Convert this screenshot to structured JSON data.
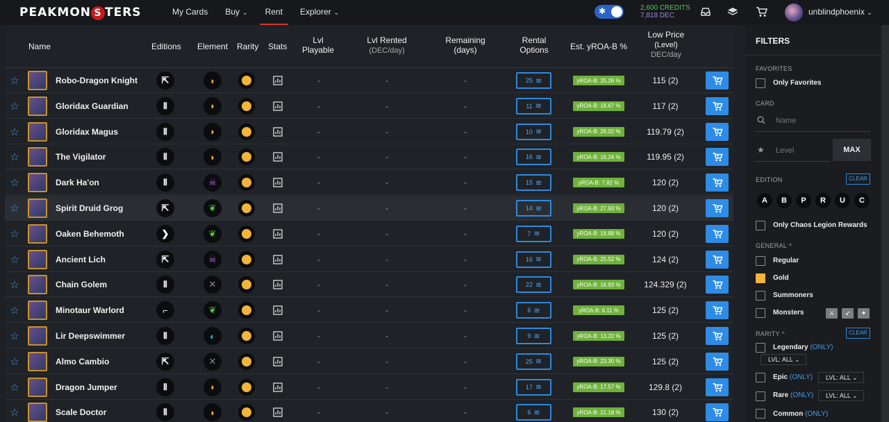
{
  "header": {
    "logo_pre": "PEAKMON",
    "logo_s": "S",
    "logo_post": "TERS",
    "nav": [
      {
        "label": "My Cards",
        "chevron": ""
      },
      {
        "label": "Buy",
        "chevron": "⌄"
      },
      {
        "label": "Rent",
        "chevron": ""
      },
      {
        "label": "Explorer",
        "chevron": "⌄"
      }
    ],
    "credits": "2,600 CREDITS",
    "dec": "7,818 DEC",
    "username": "unblindphoenix"
  },
  "table": {
    "headers": {
      "name": "Name",
      "editions": "Editions",
      "element": "Element",
      "rarity": "Rarity",
      "stats": "Stats",
      "lvl_playable_1": "Lvl",
      "lvl_playable_2": "Playable",
      "lvl_rented": "Lvl Rented",
      "lvl_rented_sub": "(DEC/day)",
      "remaining_1": "Remaining",
      "remaining_2": "(days)",
      "rental_1": "Rental",
      "rental_2": "Options",
      "yroa": "Est. yROA-B %",
      "low_price": "Low Price",
      "low_price_level": "(Level)",
      "low_price_sub": "DEC/day"
    },
    "rows": [
      {
        "name": "Robo-Dragon Knight",
        "edition": "R",
        "element": "fire",
        "options": "25",
        "yroa": "yROA-B: 25.26 %",
        "price": "115 (2)"
      },
      {
        "name": "Gloridax Guardian",
        "edition": "U",
        "element": "fire",
        "options": "11",
        "yroa": "yROA-B: 18.67 %",
        "price": "117 (2)"
      },
      {
        "name": "Gloridax Magus",
        "edition": "U",
        "element": "fire",
        "options": "10",
        "yroa": "yROA-B: 26.02 %",
        "price": "119.79 (2)"
      },
      {
        "name": "The Vigilator",
        "edition": "U",
        "element": "fire",
        "options": "16",
        "yroa": "yROA-B: 16.24 %",
        "price": "119.95 (2)"
      },
      {
        "name": "Dark Ha'on",
        "edition": "U",
        "element": "death",
        "options": "15",
        "yroa": "yROA-B: 7.82 %",
        "price": "120 (2)"
      },
      {
        "name": "Spirit Druid Grog",
        "edition": "R",
        "element": "earth",
        "options": "14",
        "yroa": "yROA-B: 27.93 %",
        "price": "120 (2)"
      },
      {
        "name": "Oaken Behemoth",
        "edition": "C",
        "element": "earth",
        "options": "7",
        "yroa": "yROA-B: 18.88 %",
        "price": "120 (2)"
      },
      {
        "name": "Ancient Lich",
        "edition": "R",
        "element": "death",
        "options": "16",
        "yroa": "yROA-B: 25.52 %",
        "price": "124 (2)"
      },
      {
        "name": "Chain Golem",
        "edition": "U",
        "element": "neutral",
        "options": "22",
        "yroa": "yROA-B: 16.93 %",
        "price": "124.329 (2)"
      },
      {
        "name": "Minotaur Warlord",
        "edition": "P",
        "element": "earth",
        "options": "6",
        "yroa": "yROA-B: 6.11 %",
        "price": "125 (2)"
      },
      {
        "name": "Lir Deepswimmer",
        "edition": "U",
        "element": "water",
        "options": "9",
        "yroa": "yROA-B: 13.22 %",
        "price": "125 (2)"
      },
      {
        "name": "Almo Cambio",
        "edition": "R",
        "element": "neutral",
        "options": "25",
        "yroa": "yROA-B: 23.30 %",
        "price": "125 (2)"
      },
      {
        "name": "Dragon Jumper",
        "edition": "U",
        "element": "fire",
        "options": "17",
        "yroa": "yROA-B: 17.57 %",
        "price": "129.8 (2)"
      },
      {
        "name": "Scale Doctor",
        "edition": "U",
        "element": "fire",
        "options": "6",
        "yroa": "yROA-B: 21.18 %",
        "price": "130 (2)"
      }
    ],
    "dash": "-"
  },
  "filters": {
    "title": "FILTERS",
    "favorites_label": "FAVORITES",
    "only_favorites": "Only Favorites",
    "card_label": "CARD",
    "name_placeholder": "Name",
    "level_placeholder": "Level",
    "max": "MAX",
    "edition_label": "EDITION",
    "clear": "CLEAR",
    "editions": [
      "A",
      "B",
      "P",
      "R",
      "U",
      "C"
    ],
    "only_chaos": "Only Chaos Legion Rewards",
    "general_label": "GENERAL ^",
    "regular": "Regular",
    "gold": "Gold",
    "summoners": "Summoners",
    "monsters": "Monsters",
    "rarity_label": "RARITY ^",
    "legendary": "Legendary",
    "epic": "Epic",
    "rare": "Rare",
    "common": "Common",
    "only": "(ONLY)",
    "lvl_all": "LVL: ALL ⌄"
  },
  "colors": {
    "accent": "#2e8ce6",
    "yroa_green": "#6fb23b",
    "gold": "#f2b43c",
    "nav_active": "#d9332c"
  }
}
